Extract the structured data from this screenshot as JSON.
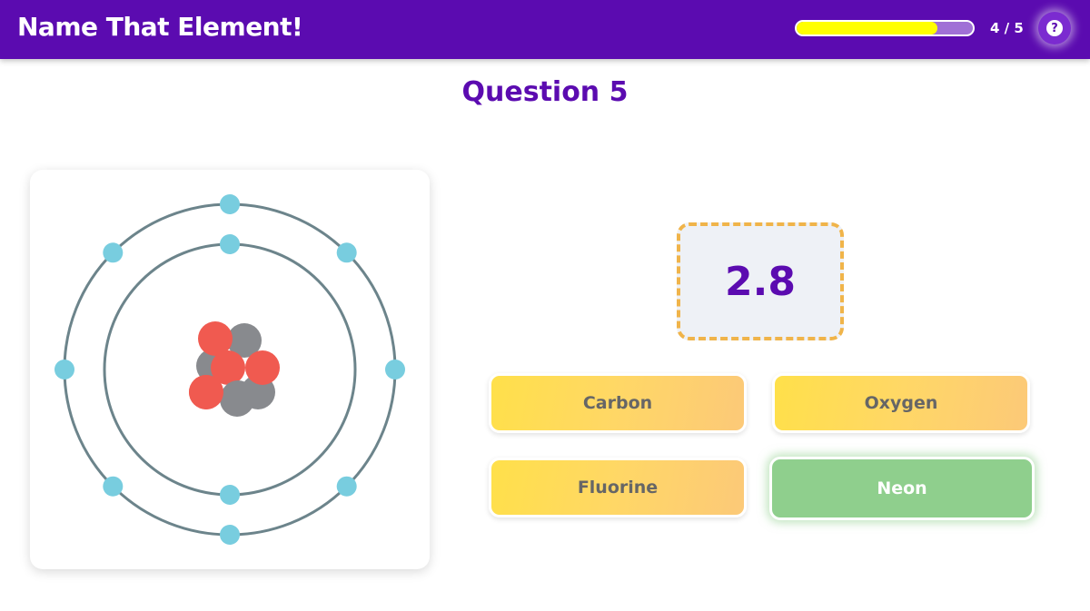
{
  "app": {
    "title": "Name That Element!"
  },
  "progress": {
    "text": "4 / 5",
    "fraction": 0.8
  },
  "help": {
    "icon": "question-mark-icon",
    "glyph": "?"
  },
  "question": {
    "title": "Question 5"
  },
  "atom": {
    "protons": 5,
    "neutrons": 5,
    "shells": [
      {
        "electrons": 2
      },
      {
        "electrons": 8
      }
    ],
    "colors": {
      "proton": "#f05a50",
      "neutron": "#888a8e",
      "electron": "#78cddf",
      "orbit": "#6c848b"
    }
  },
  "hint": {
    "value": "2.8"
  },
  "answers": [
    {
      "label": "Carbon",
      "state": "default"
    },
    {
      "label": "Oxygen",
      "state": "default"
    },
    {
      "label": "Fluorine",
      "state": "default"
    },
    {
      "label": "Neon",
      "state": "correct"
    }
  ],
  "colors": {
    "header": "#5b0bb0",
    "progress_fill": "#ffff00",
    "correct": "#8fcf8d",
    "hint_border": "#f0b44a"
  }
}
